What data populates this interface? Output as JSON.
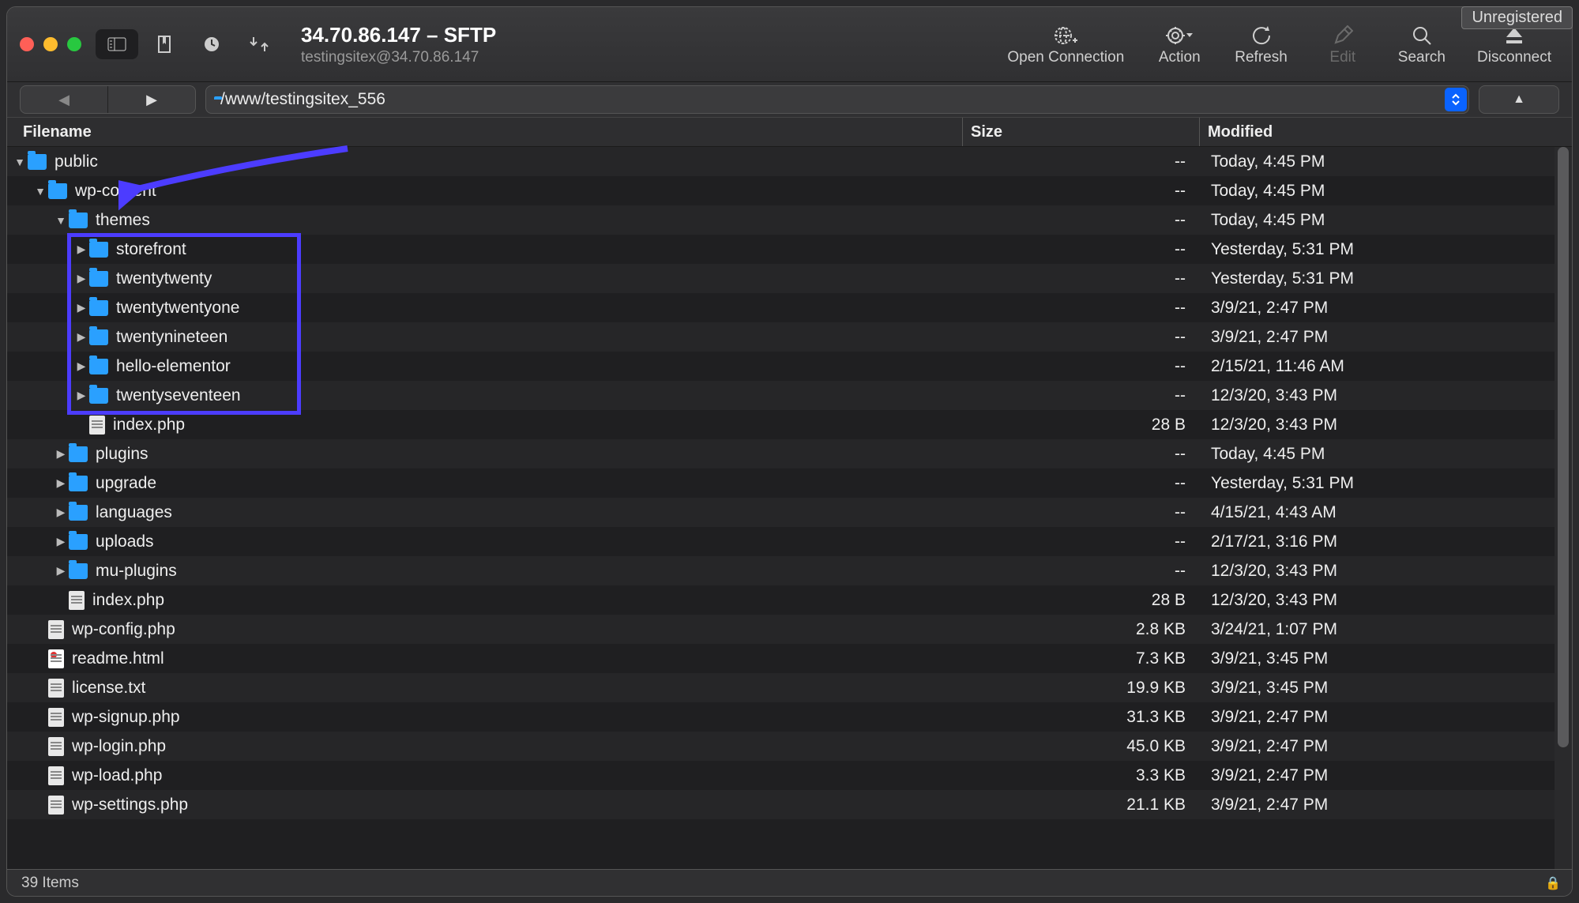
{
  "badge": "Unregistered",
  "window": {
    "title": "34.70.86.147 – SFTP",
    "subtitle": "testingsitex@34.70.86.147"
  },
  "toolbar_actions": [
    {
      "id": "open-connection",
      "label": "Open Connection",
      "icon": "globe-plus",
      "enabled": true
    },
    {
      "id": "action",
      "label": "Action",
      "icon": "gear-dropdown",
      "enabled": true
    },
    {
      "id": "refresh",
      "label": "Refresh",
      "icon": "refresh",
      "enabled": true
    },
    {
      "id": "edit",
      "label": "Edit",
      "icon": "pencil",
      "enabled": false
    },
    {
      "id": "search",
      "label": "Search",
      "icon": "magnify",
      "enabled": true
    },
    {
      "id": "disconnect",
      "label": "Disconnect",
      "icon": "eject",
      "enabled": true
    }
  ],
  "path": "/www/testingsitex_556",
  "columns": {
    "filename": "Filename",
    "size": "Size",
    "modified": "Modified"
  },
  "rows": [
    {
      "depth": 0,
      "expand": "open",
      "type": "folder",
      "name": "public",
      "size": "--",
      "modified": "Today, 4:45 PM"
    },
    {
      "depth": 1,
      "expand": "open",
      "type": "folder",
      "name": "wp-content",
      "size": "--",
      "modified": "Today, 4:45 PM"
    },
    {
      "depth": 2,
      "expand": "open",
      "type": "folder",
      "name": "themes",
      "size": "--",
      "modified": "Today, 4:45 PM"
    },
    {
      "depth": 3,
      "expand": "closed",
      "type": "folder",
      "name": "storefront",
      "size": "--",
      "modified": "Yesterday, 5:31 PM",
      "hl": true
    },
    {
      "depth": 3,
      "expand": "closed",
      "type": "folder",
      "name": "twentytwenty",
      "size": "--",
      "modified": "Yesterday, 5:31 PM",
      "hl": true
    },
    {
      "depth": 3,
      "expand": "closed",
      "type": "folder",
      "name": "twentytwentyone",
      "size": "--",
      "modified": "3/9/21, 2:47 PM",
      "hl": true
    },
    {
      "depth": 3,
      "expand": "closed",
      "type": "folder",
      "name": "twentynineteen",
      "size": "--",
      "modified": "3/9/21, 2:47 PM",
      "hl": true
    },
    {
      "depth": 3,
      "expand": "closed",
      "type": "folder",
      "name": "hello-elementor",
      "size": "--",
      "modified": "2/15/21, 11:46 AM",
      "hl": true
    },
    {
      "depth": 3,
      "expand": "closed",
      "type": "folder",
      "name": "twentyseventeen",
      "size": "--",
      "modified": "12/3/20, 3:43 PM",
      "hl": true
    },
    {
      "depth": 3,
      "expand": "none",
      "type": "file",
      "name": "index.php",
      "size": "28 B",
      "modified": "12/3/20, 3:43 PM"
    },
    {
      "depth": 2,
      "expand": "closed",
      "type": "folder",
      "name": "plugins",
      "size": "--",
      "modified": "Today, 4:45 PM"
    },
    {
      "depth": 2,
      "expand": "closed",
      "type": "folder",
      "name": "upgrade",
      "size": "--",
      "modified": "Yesterday, 5:31 PM"
    },
    {
      "depth": 2,
      "expand": "closed",
      "type": "folder",
      "name": "languages",
      "size": "--",
      "modified": "4/15/21, 4:43 AM"
    },
    {
      "depth": 2,
      "expand": "closed",
      "type": "folder",
      "name": "uploads",
      "size": "--",
      "modified": "2/17/21, 3:16 PM"
    },
    {
      "depth": 2,
      "expand": "closed",
      "type": "folder",
      "name": "mu-plugins",
      "size": "--",
      "modified": "12/3/20, 3:43 PM"
    },
    {
      "depth": 2,
      "expand": "none",
      "type": "file",
      "name": "index.php",
      "size": "28 B",
      "modified": "12/3/20, 3:43 PM"
    },
    {
      "depth": 1,
      "expand": "none",
      "type": "file",
      "name": "wp-config.php",
      "size": "2.8 KB",
      "modified": "3/24/21, 1:07 PM"
    },
    {
      "depth": 1,
      "expand": "none",
      "type": "html",
      "name": "readme.html",
      "size": "7.3 KB",
      "modified": "3/9/21, 3:45 PM"
    },
    {
      "depth": 1,
      "expand": "none",
      "type": "file",
      "name": "license.txt",
      "size": "19.9 KB",
      "modified": "3/9/21, 3:45 PM"
    },
    {
      "depth": 1,
      "expand": "none",
      "type": "file",
      "name": "wp-signup.php",
      "size": "31.3 KB",
      "modified": "3/9/21, 2:47 PM"
    },
    {
      "depth": 1,
      "expand": "none",
      "type": "file",
      "name": "wp-login.php",
      "size": "45.0 KB",
      "modified": "3/9/21, 2:47 PM"
    },
    {
      "depth": 1,
      "expand": "none",
      "type": "file",
      "name": "wp-load.php",
      "size": "3.3 KB",
      "modified": "3/9/21, 2:47 PM"
    },
    {
      "depth": 1,
      "expand": "none",
      "type": "file",
      "name": "wp-settings.php",
      "size": "21.1 KB",
      "modified": "3/9/21, 2:47 PM"
    }
  ],
  "status": "39 Items"
}
